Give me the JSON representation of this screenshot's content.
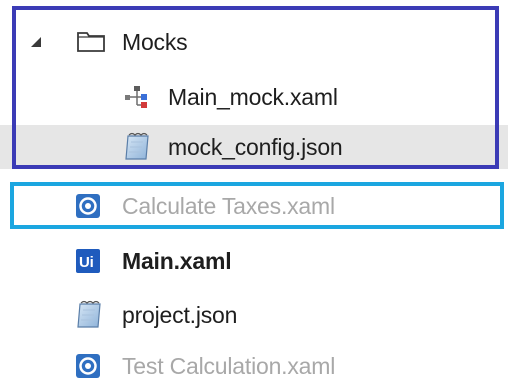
{
  "tree": {
    "folder": {
      "label": "Mocks",
      "expanded": true
    },
    "items": [
      {
        "label": "Main_mock.xaml",
        "icon": "workflow-tree-icon"
      },
      {
        "label": "mock_config.json",
        "icon": "json-file-icon",
        "selected": true
      },
      {
        "label": "Calculate Taxes.xaml",
        "icon": "test-case-icon",
        "dimmed": true
      },
      {
        "label": "Main.xaml",
        "icon": "uipath-ui-icon",
        "bold": true
      },
      {
        "label": "project.json",
        "icon": "json-file-icon"
      },
      {
        "label": "Test Calculation.xaml",
        "icon": "test-case-icon",
        "dimmed": true
      }
    ]
  },
  "colors": {
    "highlight_purple": "#3b3bb6",
    "highlight_cyan": "#1ba6e0",
    "selected_background": "#e6e6e6",
    "test_icon_blue": "#2f6fc1",
    "ui_icon_blue": "#1f5bbd",
    "dim_text": "#a8a8a8"
  }
}
